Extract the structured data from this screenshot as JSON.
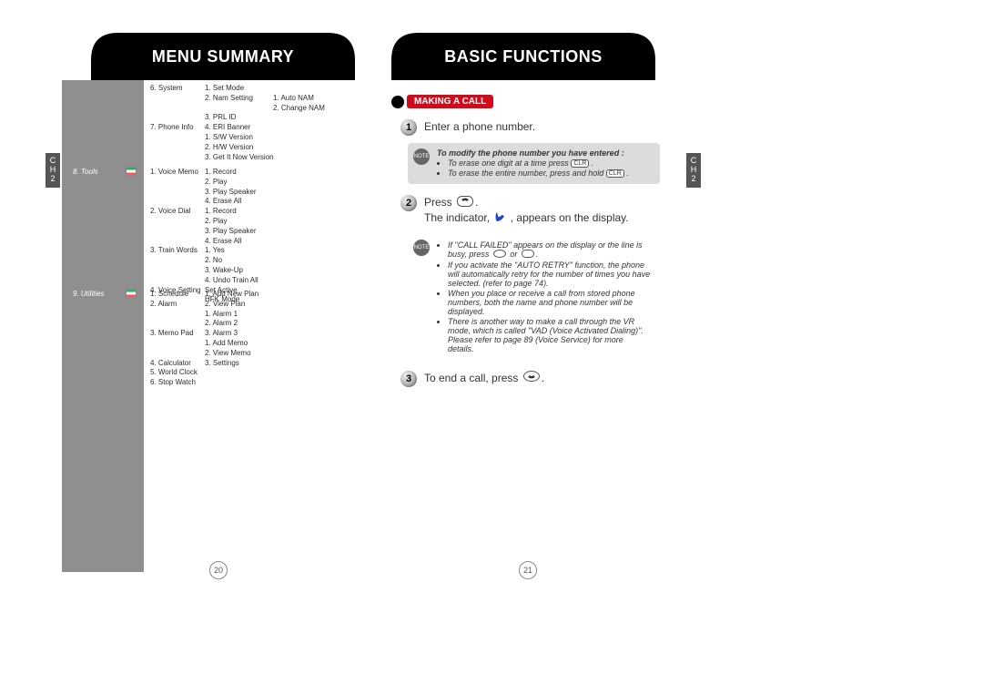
{
  "left": {
    "title": "MENU SUMMARY",
    "chapter": "C\nH\n2",
    "page_num": "20",
    "categories": {
      "tools": "8. Tools",
      "utilities": "9. Utilities"
    },
    "col1a": "6. System\n\n\n\n7. Phone Info",
    "col2a": "1. Set Mode\n2. Nam Setting\n\n3. PRL ID\n4. ERI Banner\n1. S/W Version\n2. H/W Version\n3. Get It Now Version",
    "col3a": "\n1. Auto NAM\n2. Change NAM",
    "col1b": "1. Voice Memo\n\n\n\n2. Voice Dial\n\n\n\n3. Train Words\n\n\n\n4. Voice Setting",
    "col2b": "1. Record\n2. Play\n3. Play Speaker\n4. Erase All\n1. Record\n2. Play\n3. Play Speaker\n4. Erase All\n1. Yes\n2. No\n3. Wake-Up\n4. Undo Train All\nSet Active\nHFK Mode",
    "col1c": "1. Schedule\n2. Alarm\n\n\n3. Memo Pad\n\n\n4. Calculator\n5. World Clock\n6. Stop Watch",
    "col2c": "1. Add New Plan\n2. View Plan\n1. Alarm 1\n2. Alarm 2\n3. Alarm 3\n1. Add Memo\n2. View Memo\n3. Settings"
  },
  "right": {
    "title": "BASIC FUNCTIONS",
    "chapter": "C\nH\n2",
    "page_num": "21",
    "section": "MAKING A CALL",
    "step1": "Enter a phone number.",
    "note1_title": "To modify the phone number you have entered :",
    "note1_li1": "To erase one digit at a time press",
    "note1_li2": "To erase the entire number, press and hold",
    "step2a": "Press",
    "step2b": "The indicator,",
    "step2c": ", appears on the display.",
    "note2_li1a": "If \"CALL FAILED\" appears on the display or the line is busy, press",
    "note2_li1b": "or",
    "note2_li2": "If you activate the \"AUTO RETRY\" function, the phone will automatically retry for the number of times you have selected. (refer to page 74).",
    "note2_li3": "When you place or receive a call from stored phone numbers, both the name and phone number will be displayed.",
    "note2_li4": "There is another way to make a call through the VR mode, which is called \"VAD (Voice Activated Dialing)\". Please refer to page 89 (Voice Service) for more details.",
    "step3": "To end a call, press",
    "key_clr": "CLR"
  }
}
